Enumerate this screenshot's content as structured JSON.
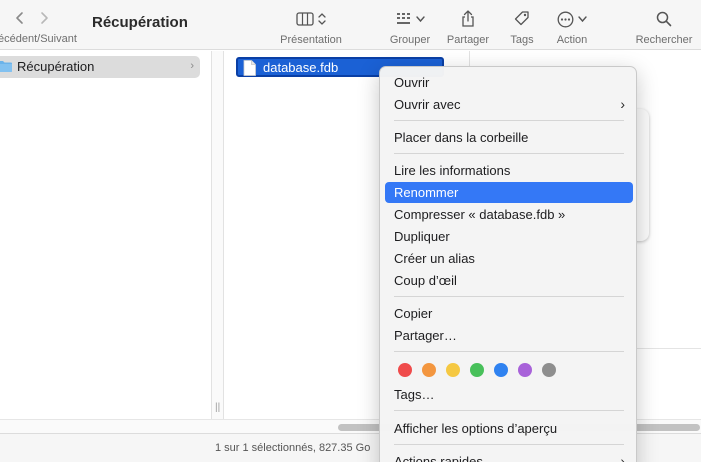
{
  "toolbar": {
    "back_icon": "chevron-left-icon",
    "forward_icon": "chevron-right-icon",
    "nav_label": "Précédent/Suivant",
    "title": "Récupération",
    "view_label": "Présentation",
    "group_label": "Grouper",
    "share_label": "Partager",
    "tags_label": "Tags",
    "action_label": "Action",
    "search_label": "Rechercher"
  },
  "column1": {
    "item_label": "Récupération",
    "item_icon": "folder-icon"
  },
  "column2": {
    "selected_file": "database.fdb",
    "file_icon": "document-icon"
  },
  "status": {
    "text": "1 sur 1 sélectionnés, 827.35 Go"
  },
  "context_menu": {
    "items": [
      {
        "label": "Ouvrir"
      },
      {
        "label": "Ouvrir avec"
      },
      {
        "label": "Placer dans la corbeille"
      },
      {
        "label": "Lire les informations"
      },
      {
        "label": "Renommer"
      },
      {
        "label": "Compresser « database.fdb »"
      },
      {
        "label": "Dupliquer"
      },
      {
        "label": "Créer un alias"
      },
      {
        "label": "Coup d’œil"
      },
      {
        "label": "Copier"
      },
      {
        "label": "Partager…"
      },
      {
        "label": "Tags…"
      },
      {
        "label": "Afficher les options d’aperçu"
      },
      {
        "label": "Actions rapides"
      }
    ],
    "tag_colors": [
      "#ef4b4b",
      "#f3963f",
      "#f5c842",
      "#48c05a",
      "#2f82f0",
      "#a862d9",
      "#8e8e8e"
    ],
    "highlight_color": "#3478f6"
  }
}
